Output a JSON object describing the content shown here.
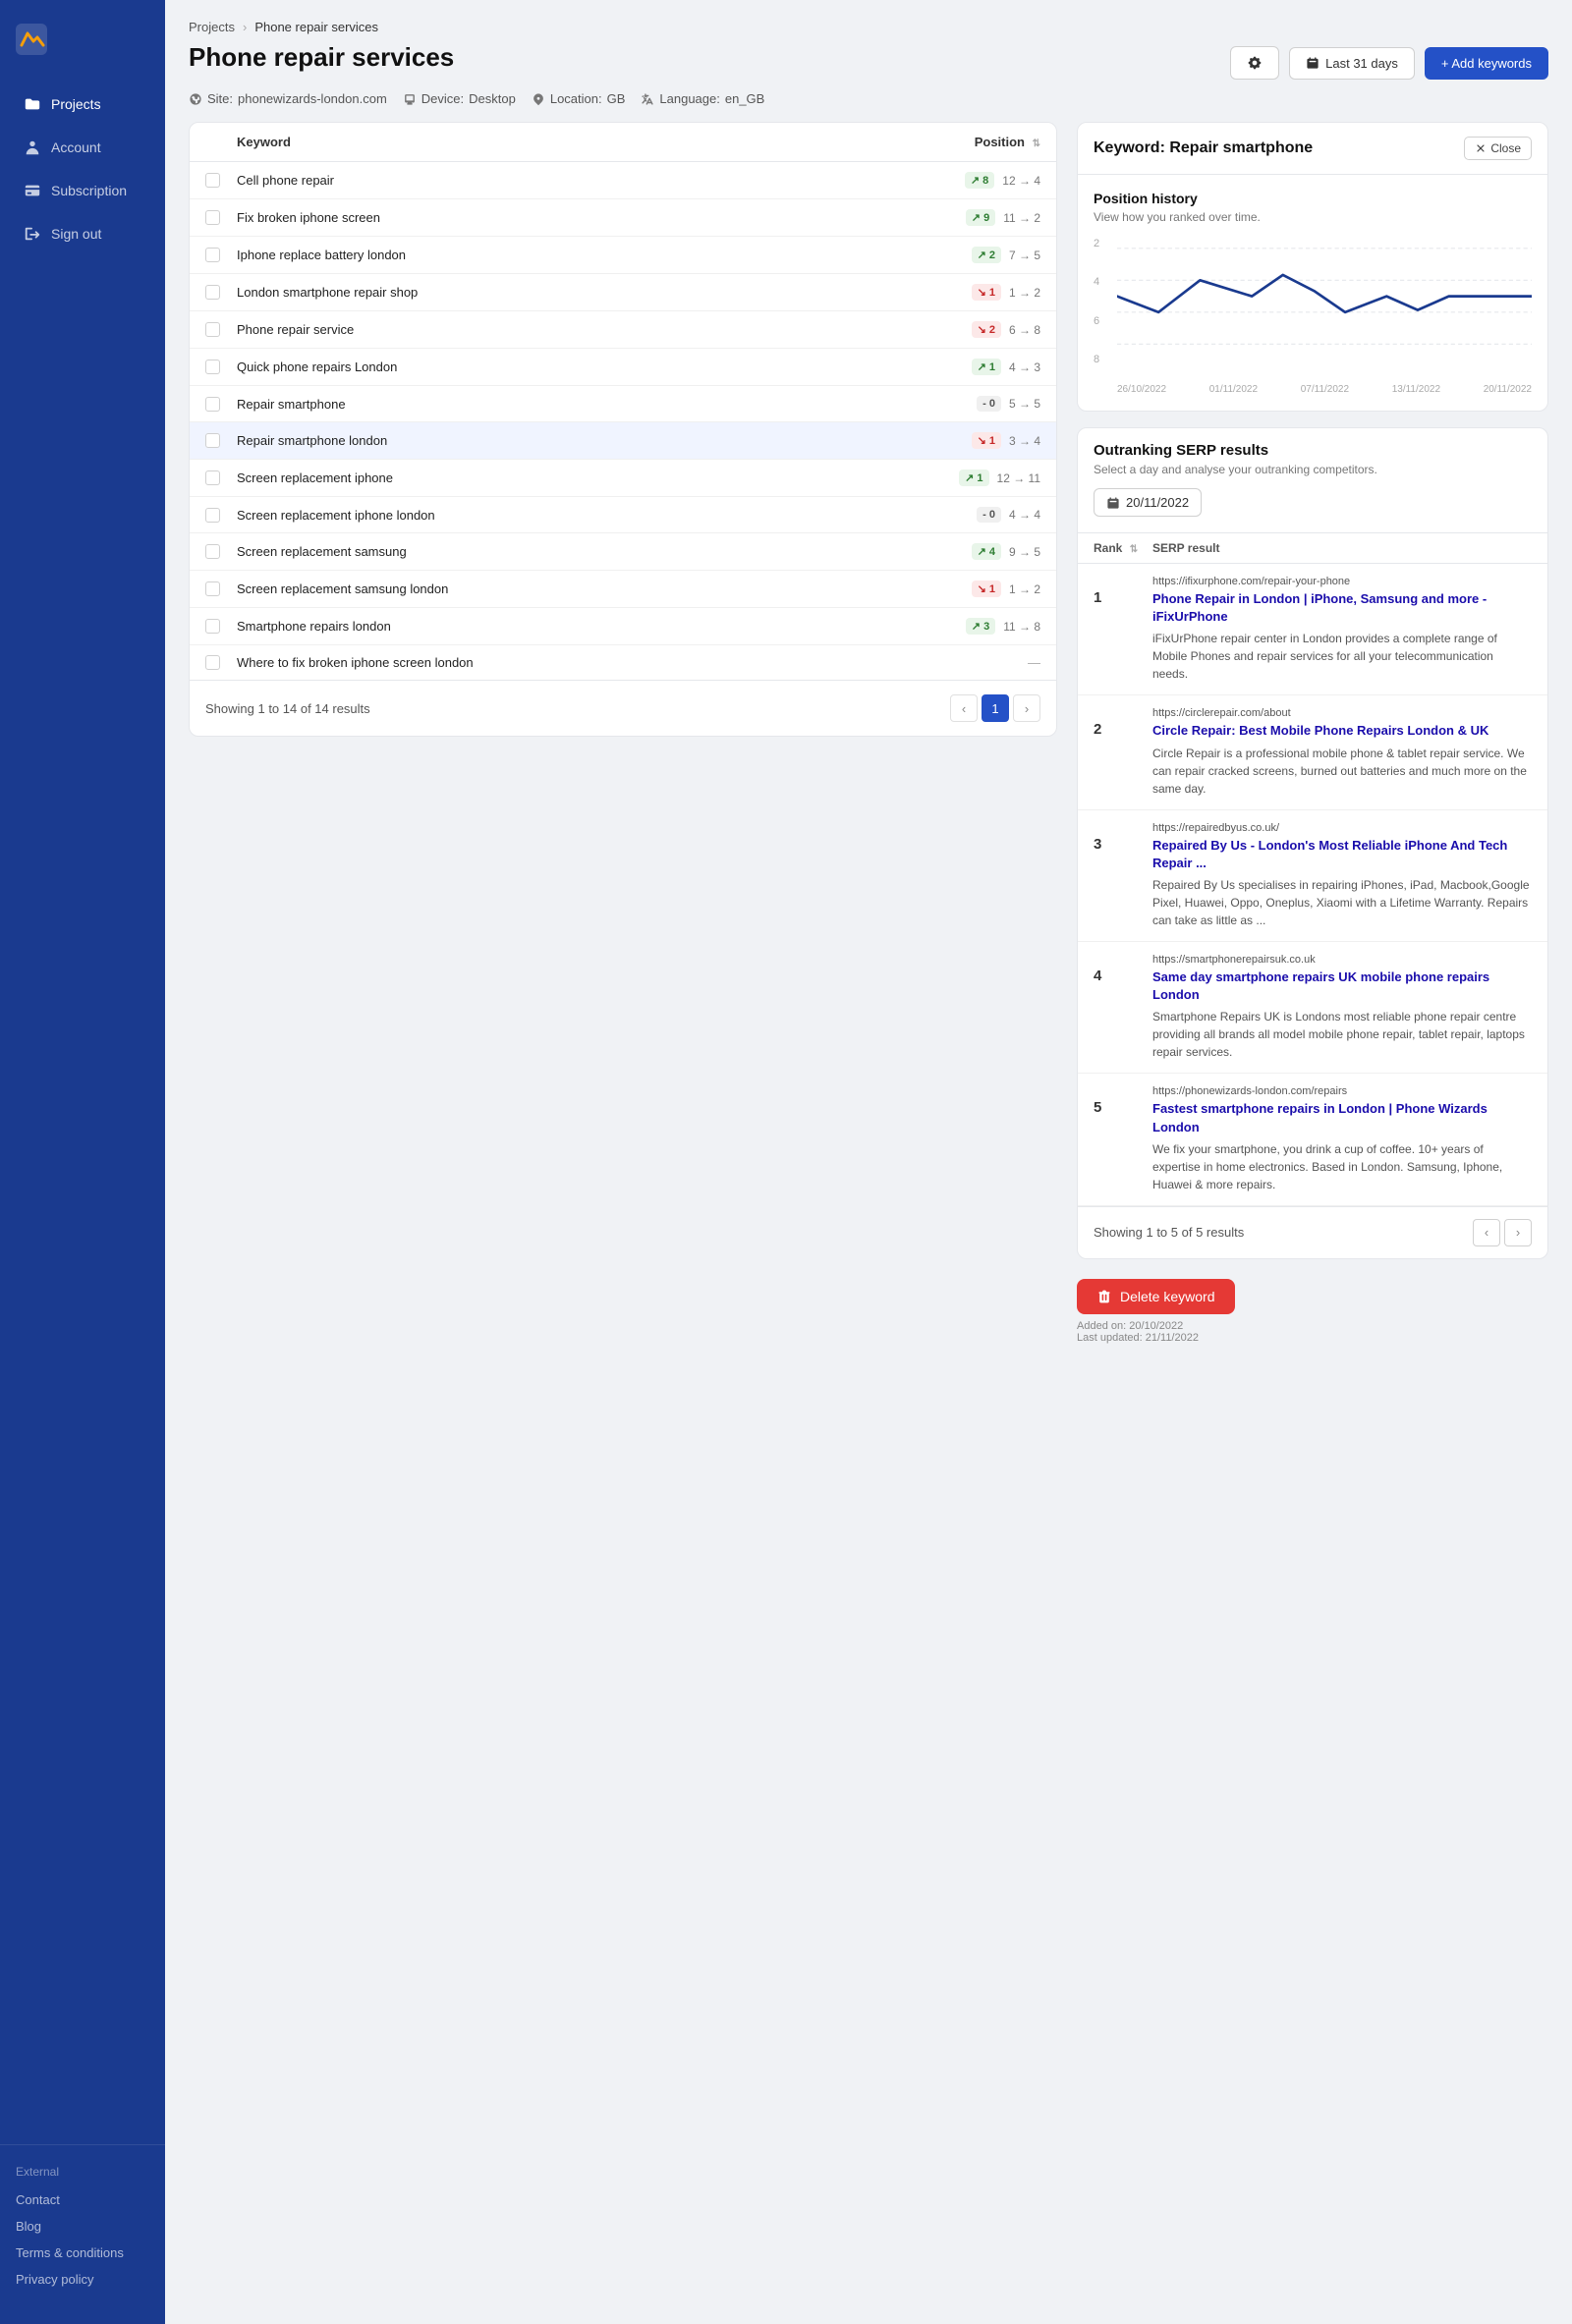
{
  "sidebar": {
    "items": [
      {
        "label": "Projects",
        "icon": "folder-icon",
        "active": true
      },
      {
        "label": "Account",
        "icon": "user-icon",
        "active": false
      },
      {
        "label": "Subscription",
        "icon": "credit-card-icon",
        "active": false
      },
      {
        "label": "Sign out",
        "icon": "logout-icon",
        "active": false
      }
    ],
    "bottom": {
      "section_label": "External",
      "links": [
        "Contact",
        "Blog",
        "Terms & conditions",
        "Privacy policy"
      ]
    }
  },
  "breadcrumb": {
    "parent": "Projects",
    "current": "Phone repair services"
  },
  "page": {
    "title": "Phone repair services",
    "meta": {
      "site": "phonewizards-london.com",
      "device": "Desktop",
      "location": "GB",
      "language": "en_GB"
    }
  },
  "header_actions": {
    "settings_label": "⚙",
    "date_range": "Last 31 days",
    "add_keywords": "+ Add keywords"
  },
  "table": {
    "columns": [
      "Keyword",
      "Position"
    ],
    "showing_text": "Showing 1 to 14 of 14 results",
    "page_current": "1",
    "rows": [
      {
        "keyword": "Cell phone repair",
        "badge_type": "up",
        "badge_val": "8",
        "pos_change": "12 → 4"
      },
      {
        "keyword": "Fix broken iphone screen",
        "badge_type": "up",
        "badge_val": "9",
        "pos_change": "11 → 2"
      },
      {
        "keyword": "Iphone replace battery london",
        "badge_type": "up",
        "badge_val": "2",
        "pos_change": "7 → 5"
      },
      {
        "keyword": "London smartphone repair shop",
        "badge_type": "down",
        "badge_val": "1",
        "pos_change": "1 → 2"
      },
      {
        "keyword": "Phone repair service",
        "badge_type": "down",
        "badge_val": "2",
        "pos_change": "6 → 8"
      },
      {
        "keyword": "Quick phone repairs London",
        "badge_type": "up",
        "badge_val": "1",
        "pos_change": "4 → 3"
      },
      {
        "keyword": "Repair smartphone",
        "badge_type": "neutral",
        "badge_val": "0",
        "pos_change": "5 → 5"
      },
      {
        "keyword": "Repair smartphone london",
        "badge_type": "down",
        "badge_val": "1",
        "pos_change": "3 → 4",
        "selected": true
      },
      {
        "keyword": "Screen replacement iphone",
        "badge_type": "up",
        "badge_val": "1",
        "pos_change": "12 → 11"
      },
      {
        "keyword": "Screen replacement iphone london",
        "badge_type": "neutral",
        "badge_val": "0",
        "pos_change": "4 → 4"
      },
      {
        "keyword": "Screen replacement samsung",
        "badge_type": "up",
        "badge_val": "4",
        "pos_change": "9 → 5"
      },
      {
        "keyword": "Screen replacement samsung london",
        "badge_type": "down",
        "badge_val": "1",
        "pos_change": "1 → 2"
      },
      {
        "keyword": "Smartphone repairs london",
        "badge_type": "up",
        "badge_val": "3",
        "pos_change": "11 → 8"
      },
      {
        "keyword": "Where to fix broken iphone screen london",
        "badge_type": "none",
        "badge_val": "",
        "pos_change": "—"
      }
    ]
  },
  "keyword_detail": {
    "title": "Keyword: Repair smartphone",
    "close_label": "Close",
    "pos_history_title": "Position history",
    "pos_history_sub": "View how you ranked over time.",
    "chart_y_labels": [
      "2",
      "4",
      "6",
      "8"
    ],
    "chart_x_labels": [
      "26/10/2022",
      "01/11/2022",
      "07/11/2022",
      "13/11/2022",
      "20/11/2022"
    ]
  },
  "serp": {
    "title": "Outranking SERP results",
    "subtitle": "Select a day and analyse your outranking competitors.",
    "selected_date": "20/11/2022",
    "columns": [
      "Rank",
      "SERP result"
    ],
    "results": [
      {
        "rank": "1",
        "url": "https://ifixurphone.com/repair-your-phone",
        "title": "Phone Repair in London | iPhone, Samsung and more - iFixUrPhone",
        "desc": "iFixUrPhone repair center in London provides a complete range of Mobile Phones and repair services for all your telecommunication needs."
      },
      {
        "rank": "2",
        "url": "https://circlerepair.com/about",
        "title": "Circle Repair: Best Mobile Phone Repairs London & UK",
        "desc": "Circle Repair is a professional mobile phone & tablet repair service. We can repair cracked screens, burned out batteries and much more on the same day."
      },
      {
        "rank": "3",
        "url": "https://repairedbyus.co.uk/",
        "title": "Repaired By Us - London's Most Reliable iPhone And Tech Repair ...",
        "desc": "Repaired By Us specialises in repairing iPhones, iPad, Macbook,Google Pixel, Huawei, Oppo, Oneplus, Xiaomi with a Lifetime Warranty. Repairs can take as little as ..."
      },
      {
        "rank": "4",
        "url": "https://smartphonerepairsuk.co.uk",
        "title": "Same day smartphone repairs UK mobile phone repairs London",
        "desc": "Smartphone Repairs UK is Londons most reliable phone repair centre providing all brands all model mobile phone repair, tablet repair, laptops repair services."
      },
      {
        "rank": "5",
        "url": "https://phonewizards-london.com/repairs",
        "title": "Fastest smartphone repairs in London | Phone Wizards London",
        "desc": "We fix your smartphone, you drink a cup of coffee. 10+ years of expertise in home electronics. Based in London. Samsung, Iphone, Huawei & more repairs."
      }
    ],
    "showing_text": "Showing 1 to 5 of 5 results"
  },
  "keyword_actions": {
    "delete_label": "Delete keyword",
    "added_on": "Added on: 20/10/2022",
    "last_updated": "Last updated: 21/11/2022"
  }
}
